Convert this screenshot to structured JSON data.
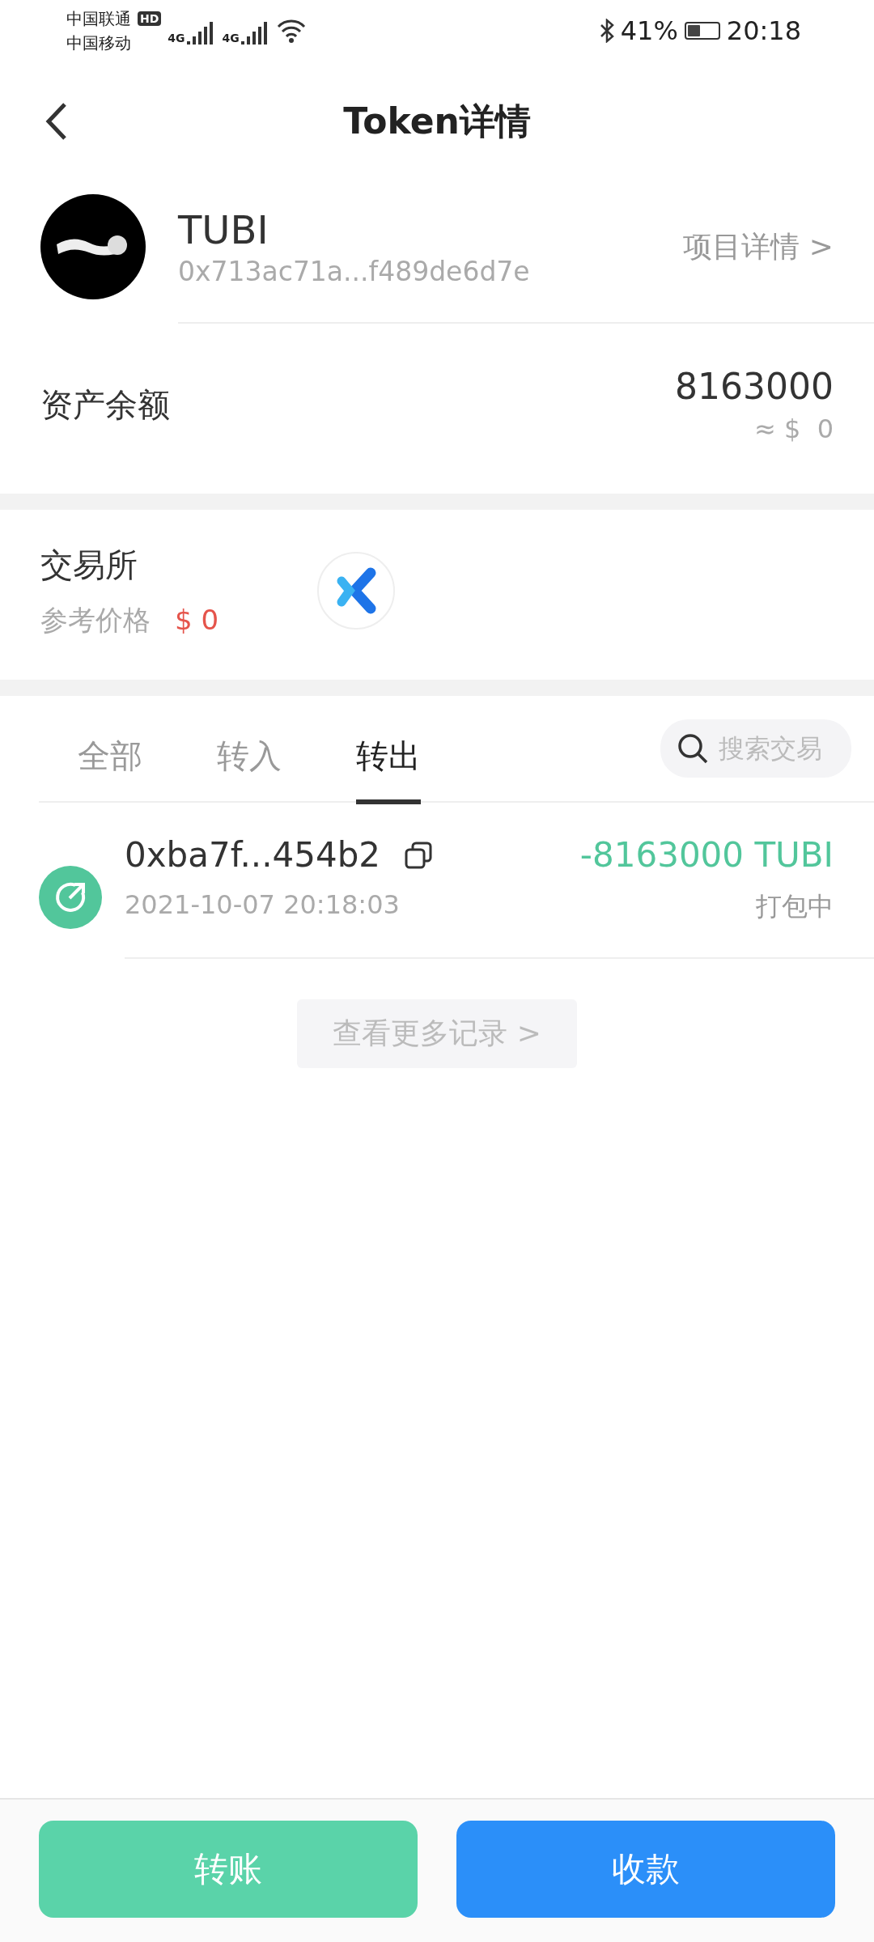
{
  "status_bar": {
    "carriers": [
      "中国联通",
      "中国移动"
    ],
    "hd_badge": "HD",
    "networks": [
      "4G",
      "4G"
    ],
    "battery_text": "41%",
    "time": "20:18"
  },
  "header": {
    "title": "Token详情"
  },
  "token": {
    "name": "TUBI",
    "address": "0x713ac71a...f489de6d7e",
    "details_link": "项目详情 >"
  },
  "balance": {
    "label": "资产余额",
    "amount": "8163000",
    "fiat": "≈ $  0"
  },
  "exchange": {
    "label": "交易所",
    "price_label": "参考价格",
    "price": "$ 0"
  },
  "tabs": [
    {
      "label": "全部",
      "selected": false
    },
    {
      "label": "转入",
      "selected": false
    },
    {
      "label": "转出",
      "selected": true
    }
  ],
  "search": {
    "placeholder": "搜索交易"
  },
  "transactions": [
    {
      "hash": "0xba7f...454b2",
      "time": "2021-10-07 20:18:03",
      "amount": "-8163000 TUBI",
      "status": "打包中",
      "kind": "out"
    }
  ],
  "more_button": "查看更多记录 >",
  "buttons": [
    {
      "label": "转账",
      "kind": "send"
    },
    {
      "label": "收款",
      "kind": "receive"
    }
  ]
}
